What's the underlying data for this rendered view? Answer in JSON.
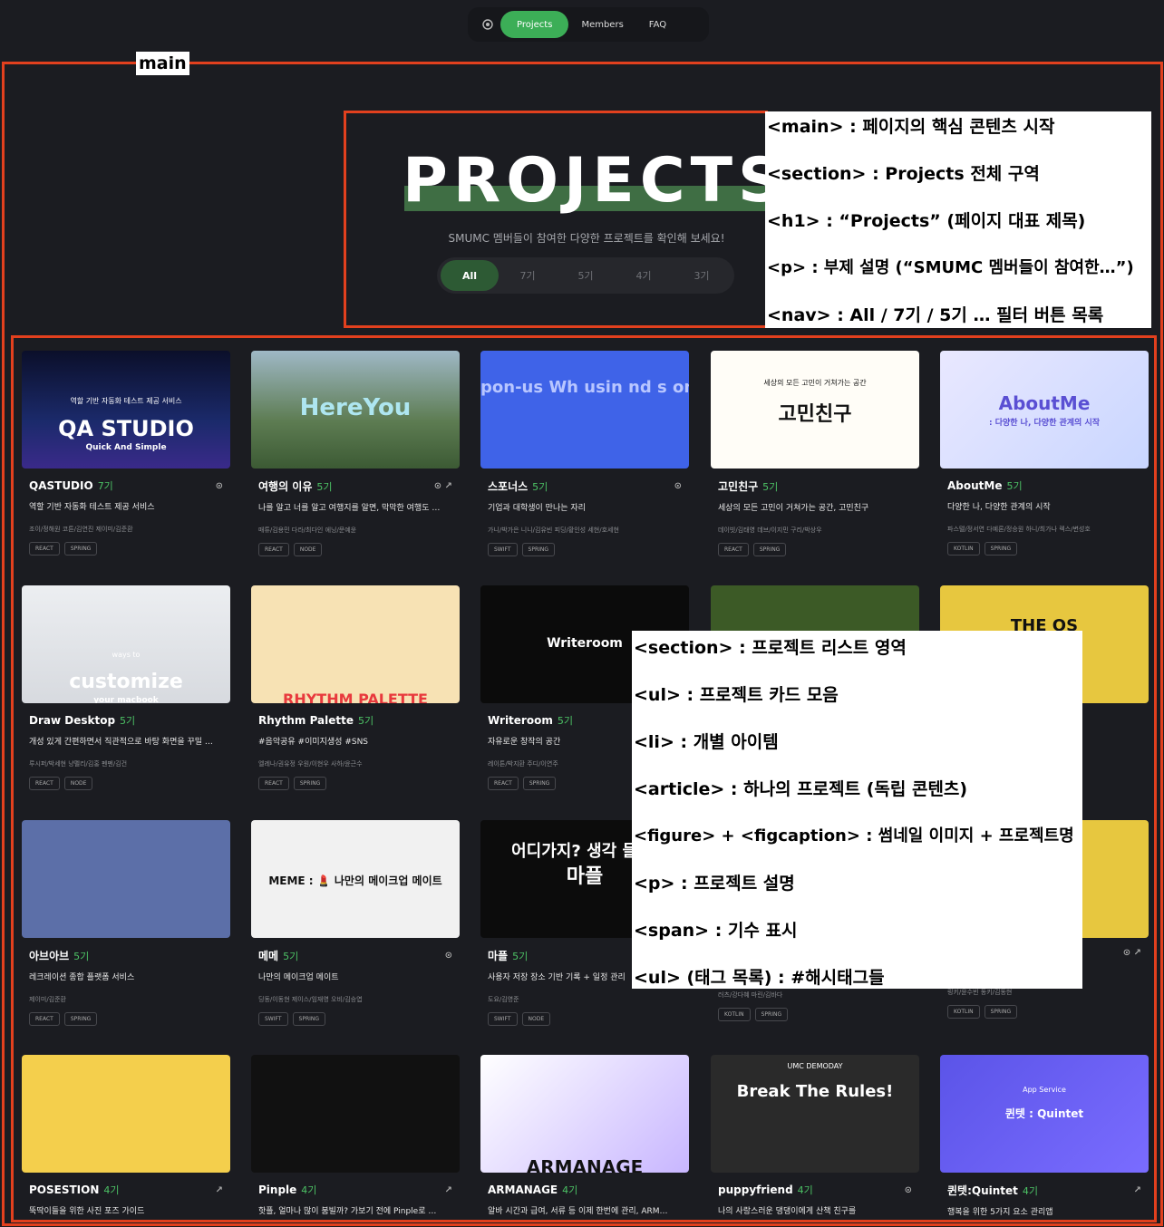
{
  "nav": {
    "items": [
      "Projects",
      "Members",
      "FAQ"
    ]
  },
  "main_label": "main",
  "hero": {
    "title": "PROJECTS",
    "subtitle": "SMUMC 멤버들이 참여한 다양한 프로젝트를 확인해 보세요!",
    "filters": [
      "All",
      "7기",
      "5기",
      "4기",
      "3기"
    ]
  },
  "annotations_top": [
    "<main> : 페이지의 핵심 콘텐츠 시작",
    "<section> : Projects 전체 구역",
    "<h1> : “Projects” (페이지 대표 제목)",
    "<p> : 부제 설명 (“SMUMC 멤버들이 참여한…”)",
    "<nav> : All / 7기 / 5기 … 필터 버튼 목록"
  ],
  "annotations_mid": [
    "<section> : 프로젝트 리스트 영역",
    "<ul> : 프로젝트 카드 모음",
    "<li> : 개별 아이템",
    "<article> : 하나의 프로젝트 (독립 콘텐츠)",
    "<figure> + <figcaption> : 썸네일 이미지 + 프로젝트명",
    "<p> : 프로젝트 설명",
    "<span> : 기수 표시",
    "<ul> (태그 목록) : #해시태그들"
  ],
  "cards": [
    {
      "title": "QASTUDIO",
      "gen": "7기",
      "icons": "⊙",
      "desc": "역할 기반 자동화 테스트 제공 서비스",
      "members": "조이/정해원   코튼/김연진   제이미/김준환",
      "tags": [
        "REACT",
        "SPRING"
      ],
      "thumb_text": "QA STUDIO",
      "thumb_sub": "Quick And Simple",
      "thumb_top": "역할 기반 자동화 테스트 제공 서비스"
    },
    {
      "title": "여행의 이유",
      "gen": "5기",
      "icons": "⊙  ↗",
      "desc": "나를 알고 너를 알고 여행지를 알면, 막막한 여행도 …",
      "members": "매튜/김용민   다라/최다인   에닝/문예윤",
      "tags": [
        "REACT",
        "NODE"
      ],
      "thumb_text": "HereYou",
      "thumb_sub": "",
      "thumb_top": ""
    },
    {
      "title": "스포너스",
      "gen": "5기",
      "icons": "⊙",
      "desc": "기업과 대학생이 만나는 자리",
      "members": "가니/박가은   니니/김유빈   피딩/황인성   세현/호세현",
      "tags": [
        "SWIFT",
        "SPRING"
      ],
      "thumb_text": "pon-us   Wh    usin   nd s    onverg",
      "thumb_sub": "",
      "thumb_top": ""
    },
    {
      "title": "고민친구",
      "gen": "5기",
      "icons": "",
      "desc": "세상의 모든 고민이 거쳐가는 공간, 고민친구",
      "members": "데이빗/김태영   데브/이지민   구리/박상우",
      "tags": [
        "REACT",
        "SPRING"
      ],
      "thumb_text": "고민친구",
      "thumb_sub": "",
      "thumb_top": "세상의 모든 고민이 거쳐가는 공간"
    },
    {
      "title": "AboutMe",
      "gen": "5기",
      "icons": "",
      "desc": "다양한 나, 다양한 관계의 시작",
      "members": "파스텔/정서연   다예론/정승원   하니/최가나   렉스/변성호",
      "tags": [
        "KOTLIN",
        "SPRING"
      ],
      "thumb_text": "AboutMe",
      "thumb_sub": ": 다양한 나, 다양한 관계의 시작",
      "thumb_top": ""
    },
    {
      "title": "Draw Desktop",
      "gen": "5기",
      "icons": "",
      "desc": "개성 있게 간편하면서 직관적으로 바탕 화면을 꾸밀 …",
      "members": "루시퍼/박세현   냥펠리/김홍   펜펜/김건",
      "tags": [
        "REACT",
        "NODE"
      ],
      "thumb_text": "customize",
      "thumb_sub": "your macbook",
      "thumb_top": "ways to"
    },
    {
      "title": "Rhythm Palette",
      "gen": "5기",
      "icons": "",
      "desc": "#음악공유 #이미지생성 #SNS",
      "members": "엘레나/권유정   우원/이현우   사하/윤근수",
      "tags": [
        "REACT",
        "SPRING"
      ],
      "thumb_text": "RHYTHM PALETTE",
      "thumb_sub": "",
      "thumb_top": ""
    },
    {
      "title": "Writeroom",
      "gen": "5기",
      "icons": "",
      "desc": "자유로운 창작의 공간",
      "members": "레이튼/박지환   주디/이연주",
      "tags": [
        "REACT",
        "SPRING"
      ],
      "thumb_text": "Writeroom",
      "thumb_sub": "",
      "thumb_top": ""
    },
    {
      "title": "",
      "gen": "",
      "icons": "",
      "desc": "",
      "members": "",
      "tags": [],
      "thumb_text": "",
      "thumb_sub": "",
      "thumb_top": ""
    },
    {
      "title": "",
      "gen": "",
      "icons": "",
      "desc": "",
      "members": "",
      "tags": [],
      "thumb_text": "THE         OS",
      "thumb_sub": "",
      "thumb_top": ""
    },
    {
      "title": "아브아브",
      "gen": "5기",
      "icons": "",
      "desc": "레크레이션 종합 플랫폼 서비스",
      "members": "제이미/김준환",
      "tags": [
        "REACT",
        "SPRING"
      ],
      "thumb_text": "",
      "thumb_sub": "",
      "thumb_top": ""
    },
    {
      "title": "메메",
      "gen": "5기",
      "icons": "⊙",
      "desc": "나만의 메이크업 메이트",
      "members": "딩동/이동현   제이스/임재영   오비/김승엽",
      "tags": [
        "SWIFT",
        "SPRING"
      ],
      "thumb_text": "MEME : 💄 나만의 메이크업 메이트",
      "thumb_sub": "",
      "thumb_top": ""
    },
    {
      "title": "마플",
      "gen": "5기",
      "icons": "",
      "desc": "사용자 저장 장소 기반 기록 + 일정 관리",
      "members": "도요/김영준",
      "tags": [
        "SWIFT",
        "NODE"
      ],
      "thumb_text": "어디가지? 생각 들 때",
      "thumb_sub": "마플",
      "thumb_top": ""
    },
    {
      "title": "",
      "gen": "",
      "icons": "",
      "desc": "",
      "members": "러츠/강다혜   마린/김바다",
      "tags": [
        "KOTLIN",
        "SPRING"
      ],
      "thumb_text": "",
      "thumb_sub": "",
      "thumb_top": ""
    },
    {
      "title": "",
      "gen": "",
      "icons": "⊙  ↗",
      "desc": "",
      "members": "링키/윤수빈   동키/김동현",
      "tags": [
        "KOTLIN",
        "SPRING"
      ],
      "thumb_text": "",
      "thumb_sub": "",
      "thumb_top": ""
    },
    {
      "title": "POSESTION",
      "gen": "4기",
      "icons": "↗",
      "desc": "뚝딱이들을 위한 사진 포즈 가이드",
      "members": "",
      "tags": [],
      "thumb_text": "",
      "thumb_sub": "",
      "thumb_top": ""
    },
    {
      "title": "Pinple",
      "gen": "4기",
      "icons": "↗",
      "desc": "핫플, 얼마나 많이 붐빌까? 가보기 전에 Pinple로 …",
      "members": "",
      "tags": [],
      "thumb_text": "",
      "thumb_sub": "",
      "thumb_top": ""
    },
    {
      "title": "ARMANAGE",
      "gen": "4기",
      "icons": "",
      "desc": "알바 시간과 급여, 서류 등 이제 한번에 관리, ARM…",
      "members": "",
      "tags": [],
      "thumb_text": "ARMANAGE",
      "thumb_sub": "",
      "thumb_top": ""
    },
    {
      "title": "puppyfriend",
      "gen": "4기",
      "icons": "⊙",
      "desc": "나의 사랑스러운 댕댕이에게 산책 친구를",
      "members": "",
      "tags": [],
      "thumb_text": "Break The Rules!",
      "thumb_sub": "",
      "thumb_top": "UMC DEMODAY"
    },
    {
      "title": "퀸텟:Quintet",
      "gen": "4기",
      "icons": "↗",
      "desc": "행복을 위한 5가지 요소 관리앱",
      "members": "",
      "tags": [],
      "thumb_text": "퀸텟 : Quintet",
      "thumb_sub": "",
      "thumb_top": "App Service"
    }
  ]
}
